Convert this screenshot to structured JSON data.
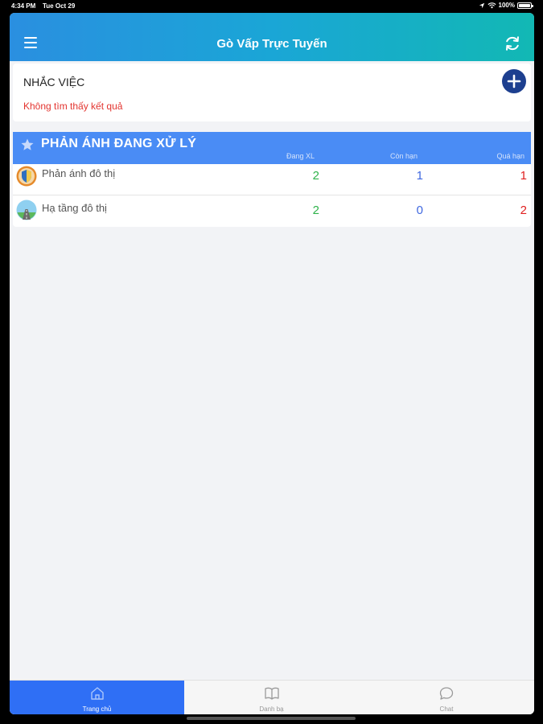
{
  "status_bar": {
    "time": "4:34 PM",
    "date": "Tue Oct 29",
    "battery": "100%",
    "battery_level": 1.0
  },
  "app_bar": {
    "title": "Gò Vấp Trực Tuyến",
    "menu_icon": "hamburger-menu-icon",
    "refresh_icon": "refresh-icon"
  },
  "reminder": {
    "heading": "NHẮC VIỆC",
    "empty_message": "Không tìm thấy kết quả",
    "add_icon": "plus-icon"
  },
  "processing": {
    "heading": "PHẢN ÁNH ĐANG XỬ LÝ",
    "columns": [
      "Đang XL",
      "Còn hạn",
      "Quá hạn"
    ],
    "rows": [
      {
        "name": "Phản ánh đô thị",
        "icon": "shield-icon",
        "values": [
          "2",
          "1",
          "1"
        ]
      },
      {
        "name": "Hạ tầng đô thị",
        "icon": "road-icon",
        "values": [
          "2",
          "0",
          "2"
        ]
      }
    ]
  },
  "tabs": [
    {
      "label": "Trang chủ",
      "icon": "home-icon",
      "active": true
    },
    {
      "label": "Danh bạ",
      "icon": "book-icon",
      "active": false
    },
    {
      "label": "Chat",
      "icon": "chat-icon",
      "active": false
    }
  ],
  "colors": {
    "header_gradient_start": "#2a8fe0",
    "header_gradient_end": "#12b8b4",
    "section_header": "#4a8cf5",
    "add_button": "#1d3f8f",
    "error_text": "#e3342f",
    "count_processing": "#2fb34b",
    "count_in_time": "#3f68e0",
    "count_overdue": "#e02020",
    "active_tab": "#2f6ff5"
  }
}
